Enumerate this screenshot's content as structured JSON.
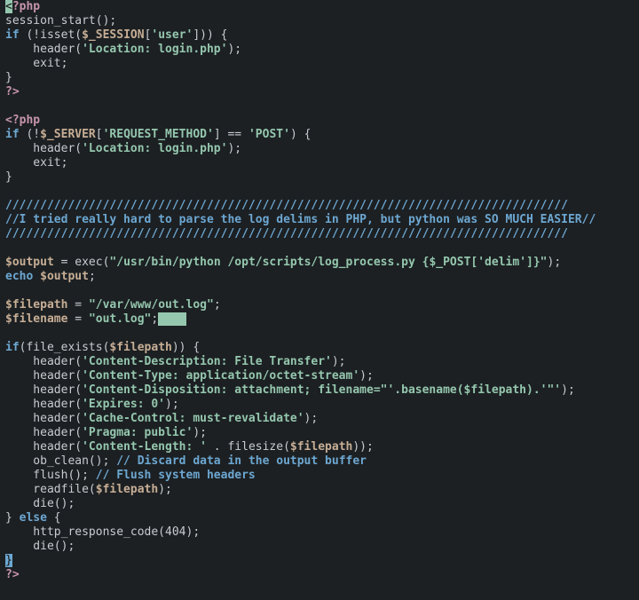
{
  "lines": {
    "l01_a": "<",
    "l01_b": "?php",
    "l02": "session_start();",
    "l03_if": "if",
    "l03_a": " (!isset(",
    "l03_v": "$_SESSION",
    "l03_b": "[",
    "l03_s": "'user'",
    "l03_c": "])) {",
    "l04_a": "    header(",
    "l04_s": "'Location: login.php'",
    "l04_b": ");",
    "l05": "    exit;",
    "l06": "}",
    "l07": "?>",
    "l08": "",
    "l09": "<?php",
    "l10_if": "if",
    "l10_a": " (!",
    "l10_v": "$_SERVER",
    "l10_b": "[",
    "l10_s1": "'REQUEST_METHOD'",
    "l10_c": "] == ",
    "l10_s2": "'POST'",
    "l10_d": ") {",
    "l11_a": "    header(",
    "l11_s": "'Location: login.php'",
    "l11_b": ");",
    "l12": "    exit;",
    "l13": "}",
    "l14": "",
    "l15": "/////////////////////////////////////////////////////////////////////////////////",
    "l16": "//I tried really hard to parse the log delims in PHP, but python was SO MUCH EASIER//",
    "l17": "/////////////////////////////////////////////////////////////////////////////////",
    "l18": "",
    "l19_v": "$output",
    "l19_a": " = exec(",
    "l19_s": "\"/usr/bin/python /opt/scripts/log_process.py {$_POST['delim']}\"",
    "l19_b": ");",
    "l20_e": "echo",
    "l20_a": " ",
    "l20_v": "$output",
    "l20_b": ";",
    "l21": "",
    "l22_v": "$filepath",
    "l22_a": " = ",
    "l22_s": "\"/var/www/out.log\"",
    "l22_b": ";",
    "l23_v": "$filename",
    "l23_a": " = ",
    "l23_s": "\"out.log\"",
    "l23_b": ";",
    "l23_cursor": "    ",
    "l24": "",
    "l25_if": "if",
    "l25_a": "(file_exists(",
    "l25_v": "$filepath",
    "l25_b": ")) {",
    "l26_a": "    header(",
    "l26_s": "'Content-Description: File Transfer'",
    "l26_b": ");",
    "l27_a": "    header(",
    "l27_s": "'Content-Type: application/octet-stream'",
    "l27_b": ");",
    "l28_a": "    header(",
    "l28_s": "'Content-Disposition: attachment; filename=\"'.basename($filepath).'\"'",
    "l28_b": ");",
    "l29_a": "    header(",
    "l29_s": "'Expires: 0'",
    "l29_b": ");",
    "l30_a": "    header(",
    "l30_s": "'Cache-Control: must-revalidate'",
    "l30_b": ");",
    "l31_a": "    header(",
    "l31_s": "'Pragma: public'",
    "l31_b": ");",
    "l32_a": "    header(",
    "l32_s": "'Content-Length: '",
    "l32_b": " . filesize(",
    "l32_v": "$filepath",
    "l32_c": "));",
    "l33_a": "    ob_clean(); ",
    "l33_c": "// Discard data in the output buffer",
    "l34_a": "    flush(); ",
    "l34_c": "// Flush system headers",
    "l35_a": "    readfile(",
    "l35_v": "$filepath",
    "l35_b": ");",
    "l36": "    die();",
    "l37_a": "} ",
    "l37_e": "else",
    "l37_b": " {",
    "l38": "    http_response_code(404);",
    "l39": "    die();",
    "l40": "}",
    "l41": "?>"
  }
}
